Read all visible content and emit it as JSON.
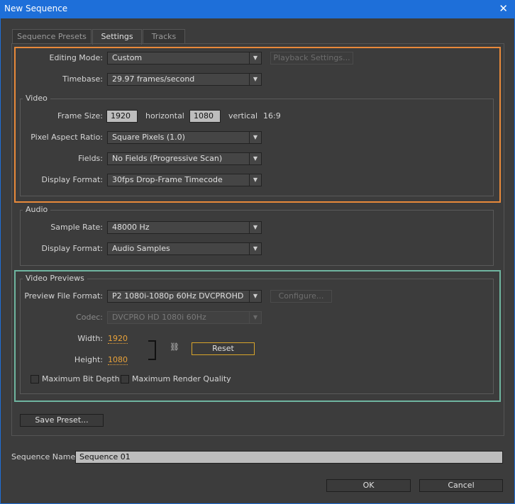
{
  "window": {
    "title": "New Sequence",
    "close_glyph": "✕"
  },
  "tabs": [
    {
      "label": "Sequence Presets",
      "active": false
    },
    {
      "label": "Settings",
      "active": true
    },
    {
      "label": "Tracks",
      "active": false
    }
  ],
  "general": {
    "editing_mode_label": "Editing Mode:",
    "editing_mode_value": "Custom",
    "playback_settings_label": "Playback Settings...",
    "timebase_label": "Timebase:",
    "timebase_value": "29.97 frames/second"
  },
  "video": {
    "legend": "Video",
    "frame_size_label": "Frame Size:",
    "frame_width": "1920",
    "horizontal_label": "horizontal",
    "frame_height": "1080",
    "vertical_label": "vertical",
    "aspect": "16:9",
    "pixel_aspect_label": "Pixel Aspect Ratio:",
    "pixel_aspect_value": "Square Pixels (1.0)",
    "fields_label": "Fields:",
    "fields_value": "No Fields (Progressive Scan)",
    "display_format_label": "Display Format:",
    "display_format_value": "30fps Drop-Frame Timecode"
  },
  "audio": {
    "legend": "Audio",
    "sample_rate_label": "Sample Rate:",
    "sample_rate_value": "48000 Hz",
    "display_format_label": "Display Format:",
    "display_format_value": "Audio Samples"
  },
  "previews": {
    "legend": "Video Previews",
    "file_format_label": "Preview File Format:",
    "file_format_value": "P2 1080i-1080p 60Hz DVCPROHD",
    "configure_label": "Configure...",
    "codec_label": "Codec:",
    "codec_value": "DVCPRO HD 1080i 60Hz",
    "width_label": "Width:",
    "width_value": "1920",
    "height_label": "Height:",
    "height_value": "1080",
    "reset_label": "Reset",
    "max_bit_depth_label": "Maximum Bit Depth",
    "max_bit_depth_checked": false,
    "max_render_quality_label": "Maximum Render Quality",
    "max_render_quality_checked": false
  },
  "save_preset_label": "Save Preset...",
  "sequence_name_label": "Sequence Name:",
  "sequence_name_value": "Sequence 01",
  "ok_label": "OK",
  "cancel_label": "Cancel",
  "icons": {
    "dropdown": "chevron-down-icon",
    "link": "chain-link-icon",
    "close": "close-icon"
  },
  "colors": {
    "titlebar": "#1e6fd9",
    "highlight_orange": "#e8893a",
    "highlight_teal": "#6fb5a0",
    "scrubby_value": "#e8a23a",
    "focus_border": "#d7a42a"
  }
}
